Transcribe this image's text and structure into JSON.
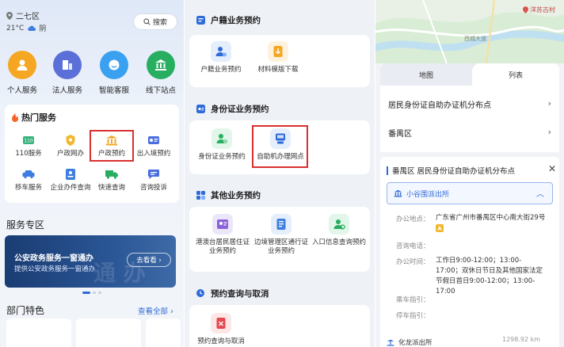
{
  "left": {
    "location": "二七区",
    "weather": "21°C",
    "weather_desc": "阴",
    "search_label": "搜索",
    "top_services": [
      {
        "label": "个人服务",
        "color": "#f5a623"
      },
      {
        "label": "法人服务",
        "color": "#5b6fd8"
      },
      {
        "label": "智能客服",
        "color": "#3aa0f0"
      },
      {
        "label": "线下站点",
        "color": "#27ae60"
      }
    ],
    "hot_title": "热门服务",
    "hot_items": [
      "110服务",
      "户政网办",
      "户政预约",
      "出入境预约",
      "移车服务",
      "企业办件查询",
      "快速查询",
      "咨询投诉"
    ],
    "zone_title": "服务专区",
    "banner_title": "公安政务服务一窗通办",
    "banner_sub": "提供公安政务服务一窗通办",
    "banner_button": "去看看 ›",
    "banner_bg_text": "通 办",
    "dept_title": "部门特色",
    "view_all": "查看全部 ›"
  },
  "middle": {
    "sections": [
      {
        "title": "户籍业务预约",
        "items": [
          "户籍业务预约",
          "材料模版下载"
        ]
      },
      {
        "title": "身份证业务预约",
        "items": [
          "身份证业务预约",
          "自助机办理网点"
        ]
      },
      {
        "title": "其他业务预约",
        "items": [
          "港澳台居民居住证业务预约",
          "边境管理区通行证业务预约",
          "入口信息查询预约"
        ]
      },
      {
        "title": "预约查询与取消",
        "items": [
          "预约查询与取消"
        ]
      }
    ]
  },
  "right": {
    "map_label": "洋苏古村",
    "map_small": "西城大道",
    "tab_map": "地图",
    "tab_list": "列表",
    "row1": "居民身份证自助办证机分布点",
    "row2": "番禺区",
    "detail_title": "番禺区 居民身份证自助办证机分布点",
    "station": "小谷围派出所",
    "fields": [
      {
        "k": "办公地点：",
        "v": "广东省广州市番禺区中心南大街29号"
      },
      {
        "k": "咨询电话：",
        "v": ""
      },
      {
        "k": "办公时间：",
        "v": "工作日9:00-12:00；13:00-17:00；双休日节日及其他国家法定节假日首日9:00-12:00；13:00-17:00"
      },
      {
        "k": "乘车指引：",
        "v": ""
      },
      {
        "k": "停车指引：",
        "v": ""
      }
    ],
    "next_station": "化龙派出所",
    "distance": "1298.92 km"
  }
}
